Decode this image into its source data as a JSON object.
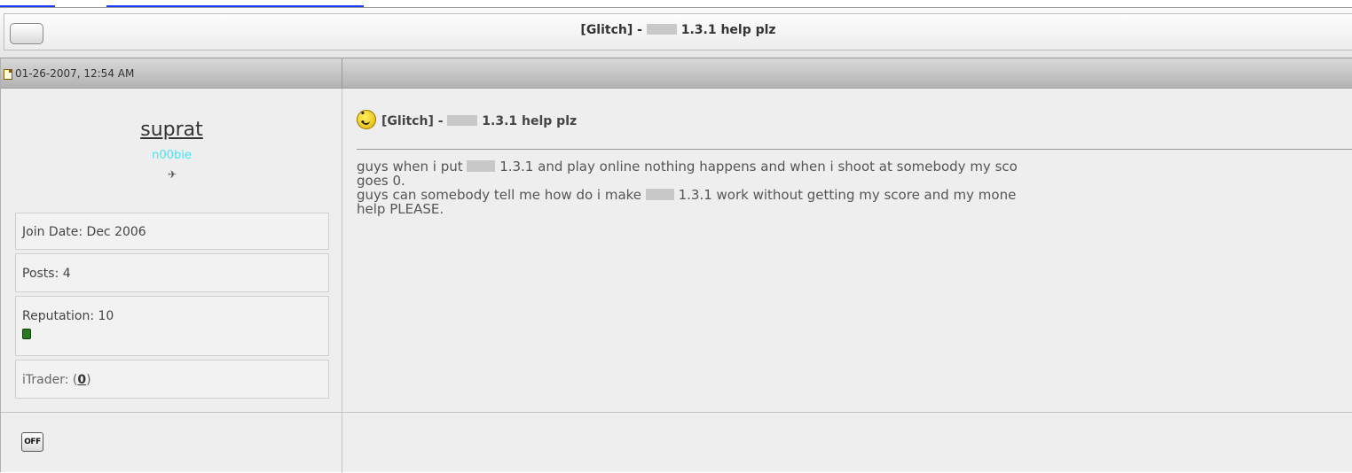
{
  "thread": {
    "title_prefix": "[Glitch] - ",
    "title_suffix": "1.3.1 help plz"
  },
  "post": {
    "date": "01-26-2007, 12:54 AM",
    "title_prefix": "[Glitch] - ",
    "title_suffix": "1.3.1 help plz",
    "body_line1_a": "guys when i put",
    "body_line1_b": "1.3.1 and play online nothing happens and when i shoot at somebody my sco",
    "body_line2": "goes 0.",
    "body_line3_a": "guys can somebody tell me how do i make",
    "body_line3_b": "1.3.1 work without getting my score and my mone",
    "body_line4": "help PLEASE."
  },
  "user": {
    "name": "suprat",
    "title": "n00bie",
    "join_date": "Join Date: Dec 2006",
    "posts": "Posts: 4",
    "reputation": "Reputation: 10",
    "itrader_label": "iTrader: (",
    "itrader_count": "0",
    "itrader_close": ")",
    "online_status": "OFF"
  }
}
